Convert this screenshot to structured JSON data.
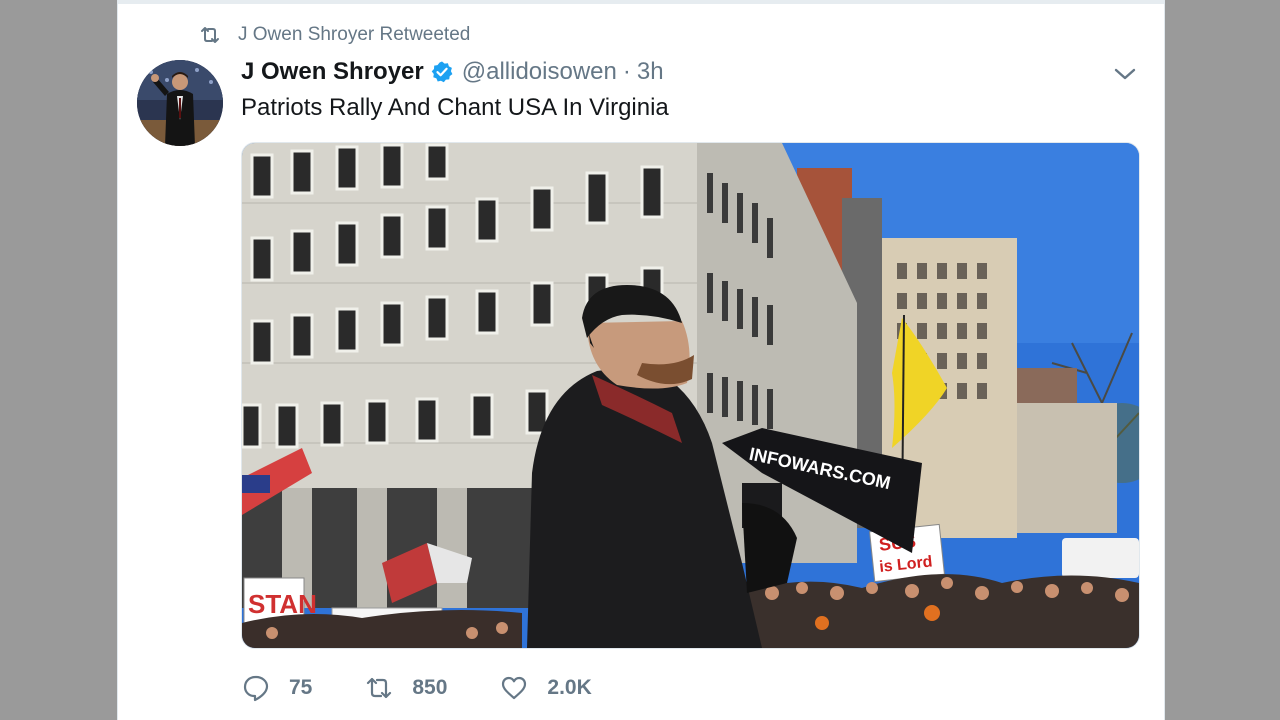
{
  "retweet_context": {
    "label": "J Owen Shroyer Retweeted",
    "icon": "retweet-icon"
  },
  "tweet": {
    "author_name": "J Owen Shroyer",
    "verified": true,
    "handle": "@allidoisowen",
    "separator": "·",
    "time": "3h",
    "text": "Patriots Rally And Chant USA In Virginia",
    "media": {
      "megaphone_text": "INFOWARS.COM",
      "sign_left": "STAN",
      "sign_right_line1": "SUS",
      "sign_right_line2": "is Lord"
    }
  },
  "actions": {
    "replies": "75",
    "retweets": "850",
    "likes": "2.0K"
  },
  "colors": {
    "secondary_text": "#657786",
    "primary_text": "#14171a",
    "verified_blue": "#1da1f2"
  }
}
